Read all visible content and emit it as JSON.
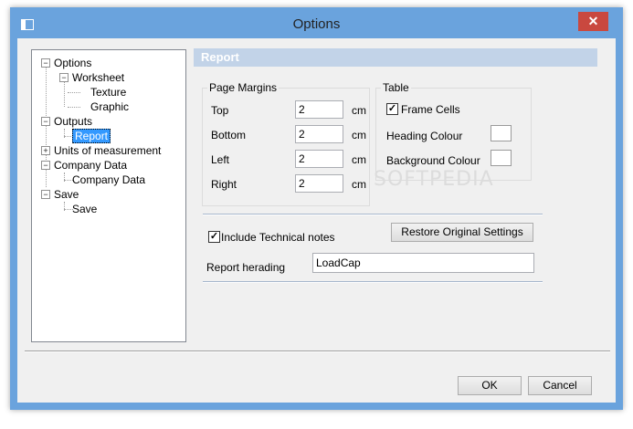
{
  "window": {
    "title": "Options",
    "close_symbol": "✕"
  },
  "tree": {
    "items": [
      {
        "label": "Options",
        "expander": "−"
      },
      {
        "label": "Worksheet",
        "expander": "−"
      },
      {
        "label": "Texture"
      },
      {
        "label": "Graphic"
      },
      {
        "label": "Outputs",
        "expander": "−"
      },
      {
        "label": "Report"
      },
      {
        "label": "Units of measurement",
        "expander": "+"
      },
      {
        "label": "Company Data",
        "expander": "−"
      },
      {
        "label": "Company Data"
      },
      {
        "label": "Save",
        "expander": "−"
      },
      {
        "label": "Save"
      }
    ]
  },
  "panel": {
    "header": "Report"
  },
  "margins": {
    "group_title": "Page Margins",
    "unit": "cm",
    "rows": [
      {
        "label": "Top",
        "value": "2"
      },
      {
        "label": "Bottom",
        "value": "2"
      },
      {
        "label": "Left",
        "value": "2"
      },
      {
        "label": "Right",
        "value": "2"
      }
    ]
  },
  "table": {
    "group_title": "Table",
    "frame_cells_label": "Frame Cells",
    "frame_cells_checked": true,
    "heading_colour_label": "Heading Colour",
    "background_colour_label": "Background Colour"
  },
  "options": {
    "include_notes_label": "Include Technical notes",
    "include_notes_checked": true,
    "restore_label": "Restore Original Settings",
    "report_heading_label": "Report herading",
    "report_heading_value": "LoadCap"
  },
  "footer": {
    "ok_label": "OK",
    "cancel_label": "Cancel"
  },
  "check_mark": "✓",
  "watermark": "SOFTPEDIA",
  "colors": {
    "title_bar": "#6aa3dd",
    "close": "#c9483f",
    "selection": "#3399ff",
    "panel_header": "#c2d3e8"
  }
}
